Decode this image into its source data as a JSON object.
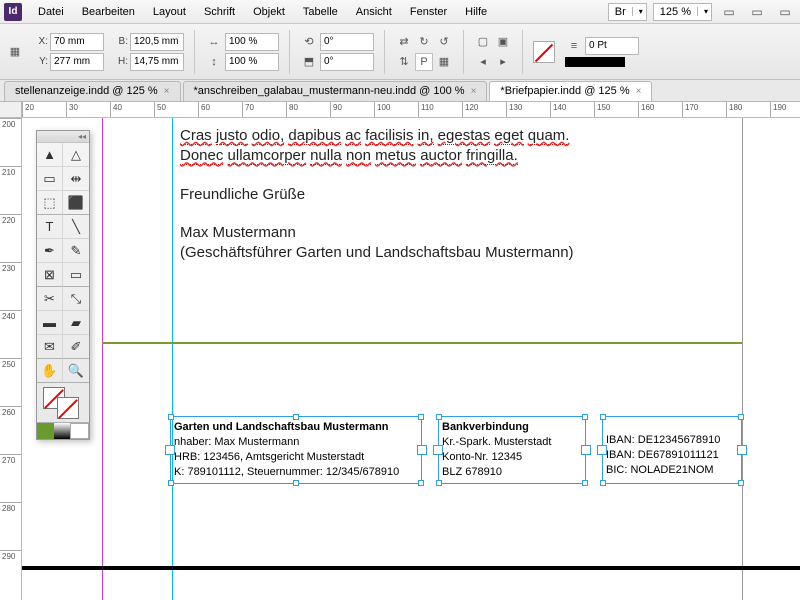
{
  "app_icon": "Id",
  "menu": [
    "Datei",
    "Bearbeiten",
    "Layout",
    "Schrift",
    "Objekt",
    "Tabelle",
    "Ansicht",
    "Fenster",
    "Hilfe"
  ],
  "bridge_label": "Br",
  "zoom": "125 %",
  "control": {
    "x": "70 mm",
    "y": "277 mm",
    "w": "120,5 mm",
    "h": "14,75 mm",
    "scale_x": "100 %",
    "scale_y": "100 %",
    "rot": "0°",
    "shear": "0°",
    "stroke_weight": "0 Pt"
  },
  "tabs": [
    {
      "label": "stellenanzeige.indd @ 125 %",
      "active": false
    },
    {
      "label": "*anschreiben_galabau_mustermann-neu.indd @ 100 %",
      "active": false
    },
    {
      "label": "*Briefpapier.indd @ 125 %",
      "active": true
    }
  ],
  "ruler_h": [
    "20",
    "30",
    "40",
    "50",
    "60",
    "70",
    "80",
    "90",
    "100",
    "110",
    "120",
    "130",
    "140",
    "150",
    "160",
    "170",
    "180",
    "190"
  ],
  "ruler_v": [
    "200",
    "210",
    "220",
    "230",
    "240",
    "250",
    "260",
    "270",
    "280",
    "290"
  ],
  "body": {
    "line1a": "Cras",
    "line1b": "justo",
    "line1c": "odio,",
    "line1d": "dapibus",
    "line1e": "ac",
    "line1f": "facilisis",
    "line1g": "in,",
    "line1h": "egestas",
    "line1i": "eget",
    "line1j": "quam.",
    "line2a": "Donec",
    "line2b": "ullamcorper",
    "line2c": "nulla",
    "line2d": "non",
    "line2e": "metus",
    "line2f": "auctor",
    "line2g": "fringilla.",
    "line3": "Freundliche Grüße",
    "line4": "Max Mustermann",
    "line5": "(Geschäftsführer Garten und Landschaftsbau Mustermann)"
  },
  "footer": {
    "col1_h": "Garten und Landschaftsbau Mustermann",
    "col1_1": "nhaber: Max Mustermann",
    "col1_2": "HRB: 123456, Amtsgericht Musterstadt",
    "col1_3": "K: 789101112, Steuernummer: 12/345/678910",
    "col2_h": "Bankverbindung",
    "col2_1": "Kr.-Spark. Musterstadt",
    "col2_2": "Konto-Nr. 12345",
    "col2_3": "BLZ 678910",
    "col3_1": "IBAN: DE12345678910",
    "col3_2": "IBAN: DE67891011121",
    "col3_3": "BIC: NOLADE21NOM"
  },
  "tools": [
    "pointer",
    "direct-select",
    "page",
    "gap",
    "content-grabber",
    "content-placer",
    "type",
    "line",
    "pen",
    "pencil",
    "rect-frame",
    "rect",
    "scissors",
    "free-transform",
    "gradient-swatch",
    "gradient-feather",
    "note",
    "eyedropper",
    "hand",
    "zoom"
  ]
}
